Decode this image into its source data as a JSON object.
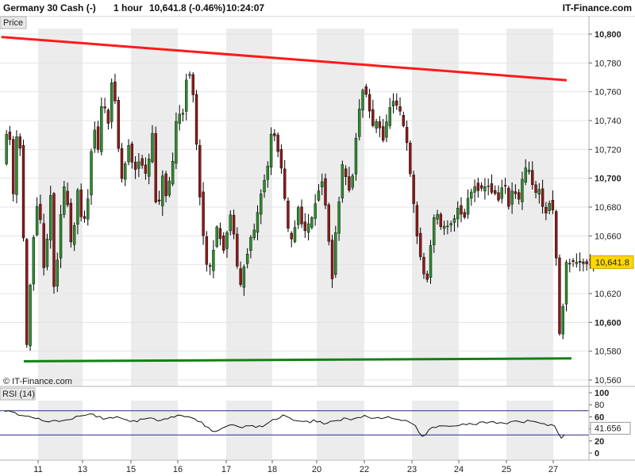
{
  "header": {
    "instrument": "Germany 30 Cash (-)",
    "interval": "1 hour",
    "quote": "10,641.8 (-0.46%)",
    "time": "10:24:07",
    "brand": "IT-Finance.com"
  },
  "colors": {
    "candle_up": "#2e8b2e",
    "candle_down": "#8b1a1a",
    "resistance": "#ff1a1a",
    "support": "#138013",
    "price_tag": "#ffd700",
    "rsi_line": "#111111",
    "rsi_band": "#2b2b8a",
    "shade": "#ececec"
  },
  "chart_data": [
    {
      "type": "candlestick",
      "title": "Germany 30 Cash (-)",
      "panel_label": "Price",
      "copyright": "© IT-Finance.com",
      "ylim": [
        10560,
        10810
      ],
      "y_ticks": [
        10560,
        10580,
        10600,
        10620,
        10640,
        10660,
        10680,
        10700,
        10720,
        10740,
        10760,
        10780,
        10800
      ],
      "y_tick_labels": [
        "10,560",
        "10,580",
        "10,600",
        "10,620",
        "10,640",
        "10,660",
        "10,680",
        "10,700",
        "10,720",
        "10,740",
        "10,760",
        "10,780",
        "10,800"
      ],
      "bold_ticks": [
        10600,
        10700,
        10800
      ],
      "last_price": 10641.8,
      "last_price_label": "10,641.8",
      "x_tick_labels": [
        "11",
        "13",
        "15",
        "16",
        "17",
        "18",
        "20",
        "22",
        "23",
        "24",
        "25",
        "27"
      ],
      "price_path": [
        [
          0,
          10712
        ],
        [
          0.8,
          10742
        ],
        [
          1.5,
          10690
        ],
        [
          2.2,
          10745
        ],
        [
          2.8,
          10700
        ],
        [
          3.4,
          10575
        ],
        [
          4.3,
          10650
        ],
        [
          5.2,
          10690
        ],
        [
          6.1,
          10630
        ],
        [
          7.0,
          10690
        ],
        [
          7.6,
          10610
        ],
        [
          8.3,
          10668
        ],
        [
          9.2,
          10700
        ],
        [
          10.1,
          10650
        ],
        [
          11.0,
          10690
        ],
        [
          11.7,
          10665
        ],
        [
          12.4,
          10680
        ],
        [
          13.3,
          10740
        ],
        [
          14.0,
          10720
        ],
        [
          14.7,
          10760
        ],
        [
          15.4,
          10735
        ],
        [
          16.2,
          10775
        ],
        [
          16.9,
          10725
        ],
        [
          17.6,
          10695
        ],
        [
          18.4,
          10725
        ],
        [
          19.3,
          10705
        ],
        [
          20.2,
          10715
        ],
        [
          21.1,
          10700
        ],
        [
          22.0,
          10730
        ],
        [
          22.7,
          10665
        ],
        [
          23.4,
          10705
        ],
        [
          24.1,
          10685
        ],
        [
          25.0,
          10710
        ],
        [
          25.7,
          10750
        ],
        [
          26.4,
          10740
        ],
        [
          27.1,
          10775
        ],
        [
          27.8,
          10768
        ],
        [
          28.3,
          10740
        ],
        [
          28.8,
          10700
        ],
        [
          29.5,
          10660
        ],
        [
          30.2,
          10630
        ],
        [
          30.9,
          10648
        ],
        [
          31.6,
          10668
        ],
        [
          32.5,
          10650
        ],
        [
          33.4,
          10675
        ],
        [
          34.1,
          10660
        ],
        [
          34.8,
          10620
        ],
        [
          35.5,
          10640
        ],
        [
          36.3,
          10655
        ],
        [
          37.2,
          10665
        ],
        [
          38.0,
          10690
        ],
        [
          38.9,
          10705
        ],
        [
          39.6,
          10735
        ],
        [
          40.5,
          10720
        ],
        [
          41.2,
          10700
        ],
        [
          41.9,
          10665
        ],
        [
          42.6,
          10655
        ],
        [
          43.5,
          10680
        ],
        [
          44.4,
          10662
        ],
        [
          45.3,
          10670
        ],
        [
          46.2,
          10688
        ],
        [
          47.1,
          10700
        ],
        [
          47.8,
          10665
        ],
        [
          48.5,
          10632
        ],
        [
          49.2,
          10672
        ],
        [
          50.1,
          10712
        ],
        [
          50.8,
          10690
        ],
        [
          51.5,
          10702
        ],
        [
          52.2,
          10738
        ],
        [
          53.1,
          10765
        ],
        [
          53.8,
          10752
        ],
        [
          54.5,
          10735
        ],
        [
          55.2,
          10742
        ],
        [
          56.1,
          10725
        ],
        [
          56.8,
          10748
        ],
        [
          57.5,
          10752
        ],
        [
          58.2,
          10748
        ],
        [
          58.9,
          10740
        ],
        [
          59.6,
          10720
        ],
        [
          60.3,
          10690
        ],
        [
          61.0,
          10660
        ],
        [
          61.7,
          10640
        ],
        [
          62.4,
          10625
        ],
        [
          63.1,
          10660
        ],
        [
          63.8,
          10680
        ],
        [
          64.5,
          10665
        ],
        [
          65.2,
          10665
        ],
        [
          66.1,
          10668
        ],
        [
          67.0,
          10680
        ],
        [
          67.9,
          10672
        ],
        [
          68.6,
          10688
        ],
        [
          69.5,
          10695
        ],
        [
          70.4,
          10692
        ],
        [
          71.3,
          10696
        ],
        [
          72.2,
          10690
        ],
        [
          73.1,
          10685
        ],
        [
          73.8,
          10700
        ],
        [
          74.5,
          10680
        ],
        [
          75.2,
          10695
        ],
        [
          75.9,
          10682
        ],
        [
          76.6,
          10700
        ],
        [
          77.3,
          10710
        ],
        [
          78.2,
          10690
        ],
        [
          79.1,
          10692
        ],
        [
          79.8,
          10672
        ],
        [
          80.7,
          10688
        ],
        [
          81.4,
          10660
        ],
        [
          81.8,
          10600
        ],
        [
          82.2,
          10582
        ],
        [
          82.8,
          10642
        ]
      ],
      "trendlines": [
        {
          "name": "resistance",
          "from": [
            -0.5,
            10798
          ],
          "to": [
            82.8,
            10768
          ]
        },
        {
          "name": "support",
          "from": [
            2.8,
            10573
          ],
          "to": [
            83.5,
            10575
          ]
        }
      ]
    },
    {
      "type": "line",
      "title": "RSI (14)",
      "ylim": [
        0,
        100
      ],
      "y_ticks": [
        0,
        20,
        40,
        60,
        80,
        100
      ],
      "bold_ticks": [
        0,
        20,
        60,
        100
      ],
      "bands": [
        30,
        70
      ],
      "last_value": 41.656,
      "last_value_label": "41.656",
      "rsi_path": [
        [
          0,
          69
        ],
        [
          1.5,
          67
        ],
        [
          3.0,
          61
        ],
        [
          4.5,
          58
        ],
        [
          6.0,
          54
        ],
        [
          7.5,
          53
        ],
        [
          9.0,
          54
        ],
        [
          10.5,
          60
        ],
        [
          12.0,
          64
        ],
        [
          13.5,
          62
        ],
        [
          15.0,
          56
        ],
        [
          16.5,
          60
        ],
        [
          18.0,
          54
        ],
        [
          19.5,
          54
        ],
        [
          21.0,
          57
        ],
        [
          22.5,
          55
        ],
        [
          24.0,
          59
        ],
        [
          25.5,
          63
        ],
        [
          27.0,
          60
        ],
        [
          28.0,
          55
        ],
        [
          29.0,
          52
        ],
        [
          30.5,
          35
        ],
        [
          32.0,
          40
        ],
        [
          33.5,
          48
        ],
        [
          35.0,
          43
        ],
        [
          36.5,
          46
        ],
        [
          38.0,
          42
        ],
        [
          39.5,
          55
        ],
        [
          41.0,
          62
        ],
        [
          42.5,
          56
        ],
        [
          44.0,
          50
        ],
        [
          45.5,
          53
        ],
        [
          47.0,
          49
        ],
        [
          48.5,
          52
        ],
        [
          50.0,
          58
        ],
        [
          51.5,
          55
        ],
        [
          53.0,
          62
        ],
        [
          54.5,
          57
        ],
        [
          56.0,
          60
        ],
        [
          57.5,
          55
        ],
        [
          59.0,
          52
        ],
        [
          60.5,
          45
        ],
        [
          61.5,
          28
        ],
        [
          62.2,
          33
        ],
        [
          63.0,
          42
        ],
        [
          64.5,
          43
        ],
        [
          66.0,
          46
        ],
        [
          67.5,
          48
        ],
        [
          69.0,
          47
        ],
        [
          70.5,
          51
        ],
        [
          72.0,
          50
        ],
        [
          73.5,
          47
        ],
        [
          75.0,
          52
        ],
        [
          76.5,
          51
        ],
        [
          78.0,
          54
        ],
        [
          79.5,
          48
        ],
        [
          81.0,
          44
        ],
        [
          81.8,
          28
        ],
        [
          82.2,
          20
        ],
        [
          82.8,
          40
        ]
      ]
    }
  ]
}
